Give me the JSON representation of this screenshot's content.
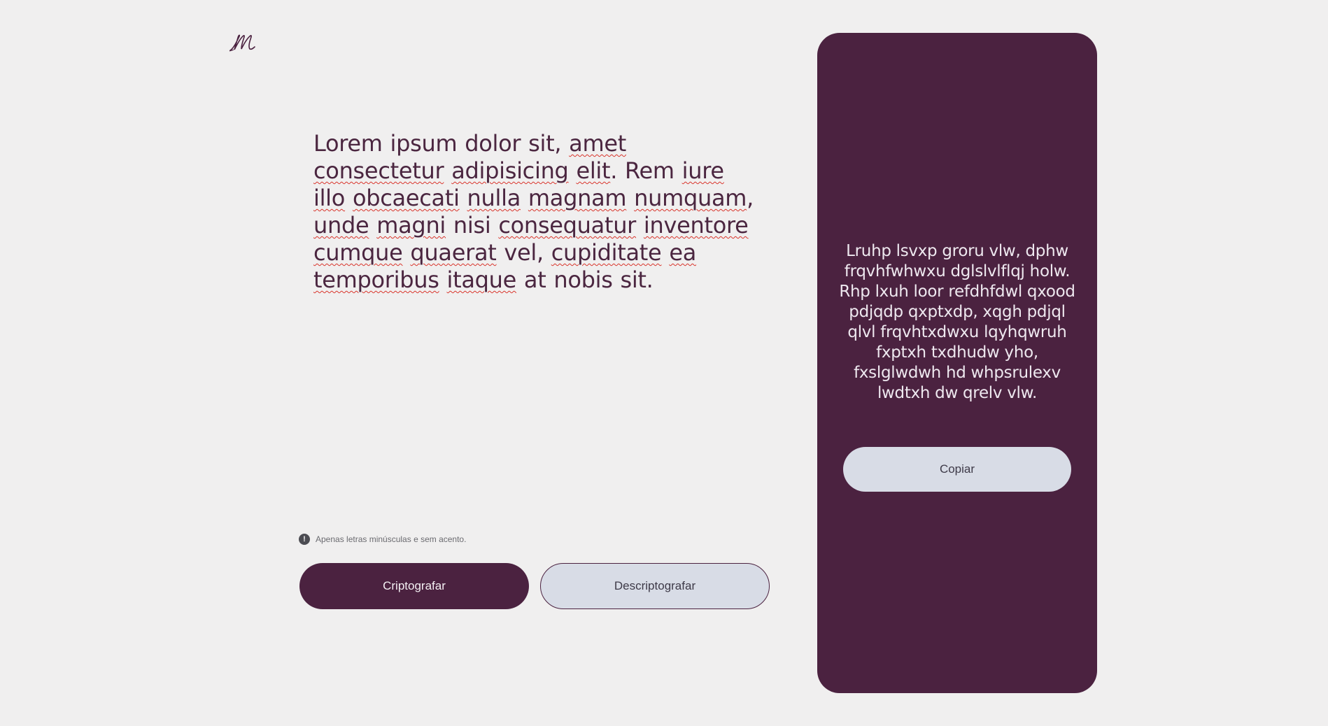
{
  "logo": {
    "icon": "script-m-logo",
    "color": "#4b2240"
  },
  "input": {
    "words": [
      {
        "t": "Lorem",
        "s": false
      },
      {
        "t": "ipsum",
        "s": false
      },
      {
        "t": "dolor",
        "s": false
      },
      {
        "t": "sit,",
        "s": false
      },
      {
        "t": "amet",
        "s": true
      },
      {
        "t": "consectetur",
        "s": true
      },
      {
        "t": "adipisicing",
        "s": true
      },
      {
        "t": "elit",
        "s": true,
        "p": "."
      },
      {
        "t": "Rem",
        "s": false
      },
      {
        "t": "iure",
        "s": true
      },
      {
        "t": "illo",
        "s": true
      },
      {
        "t": "obcaecati",
        "s": true
      },
      {
        "t": "nulla",
        "s": true
      },
      {
        "t": "magnam",
        "s": true
      },
      {
        "t": "numquam",
        "s": true,
        "p": ","
      },
      {
        "t": "unde",
        "s": true
      },
      {
        "t": "magni",
        "s": true
      },
      {
        "t": "nisi",
        "s": false
      },
      {
        "t": "consequatur",
        "s": true
      },
      {
        "t": "inventore",
        "s": true
      },
      {
        "t": "cumque",
        "s": true
      },
      {
        "t": "quaerat",
        "s": true
      },
      {
        "t": "vel,",
        "s": false
      },
      {
        "t": "cupiditate",
        "s": true
      },
      {
        "t": "ea",
        "s": true
      },
      {
        "t": "temporibus",
        "s": true
      },
      {
        "t": "itaque",
        "s": true
      },
      {
        "t": "at",
        "s": false
      },
      {
        "t": "nobis",
        "s": false
      },
      {
        "t": "sit.",
        "s": false
      }
    ]
  },
  "hint": {
    "icon": "exclamation-circle-icon",
    "text": "Apenas letras minúsculas e sem acento."
  },
  "buttons": {
    "encrypt": "Criptografar",
    "decrypt": "Descriptografar"
  },
  "output": {
    "text": "Lruhp lsvxp groru vlw, dphw frqvhfwhwxu dglslvlflqj holw. Rhp lxuh loor refdhfdwl qxood pdjqdp qxptxdp, xqgh pdjql qlvl frqvhtxdwxu lqyhqwruh fxptxh txdhudw yho, fxslglwdwh hd whpsrulexv lwdtxh dw qrelv vlw.",
    "copy_label": "Copiar"
  },
  "colors": {
    "brand": "#4b2240",
    "light_button": "#d8dce6",
    "background": "#f0efef"
  }
}
